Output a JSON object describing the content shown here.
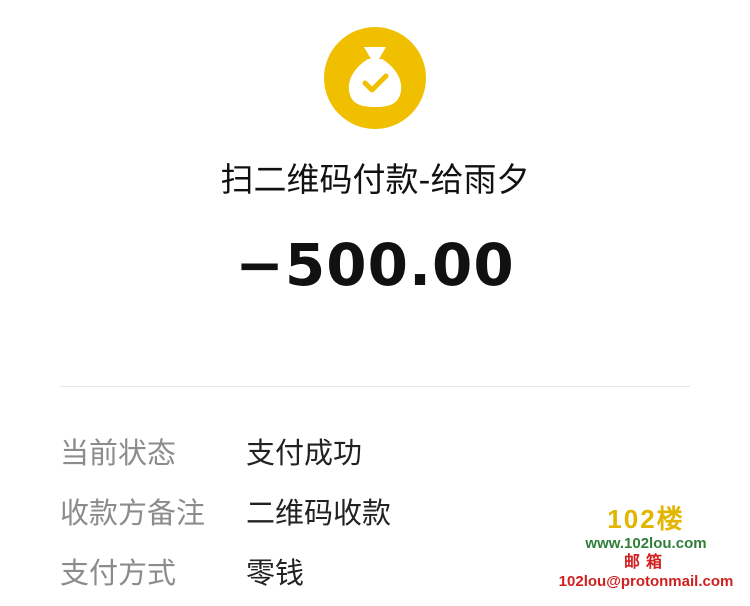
{
  "header": {
    "icon": "money-bag-check-icon",
    "icon_color": "#f0c000",
    "title": "扫二维码付款-给雨夕",
    "amount": "−500.00"
  },
  "details": [
    {
      "label": "当前状态",
      "value": "支付成功"
    },
    {
      "label": "收款方备注",
      "value": "二维码收款"
    },
    {
      "label": "支付方式",
      "value": "零钱"
    }
  ],
  "watermark": {
    "logo": "102楼",
    "site": "www.102lou.com",
    "mail_label": "邮箱",
    "email": "102lou@protonmail.com"
  }
}
